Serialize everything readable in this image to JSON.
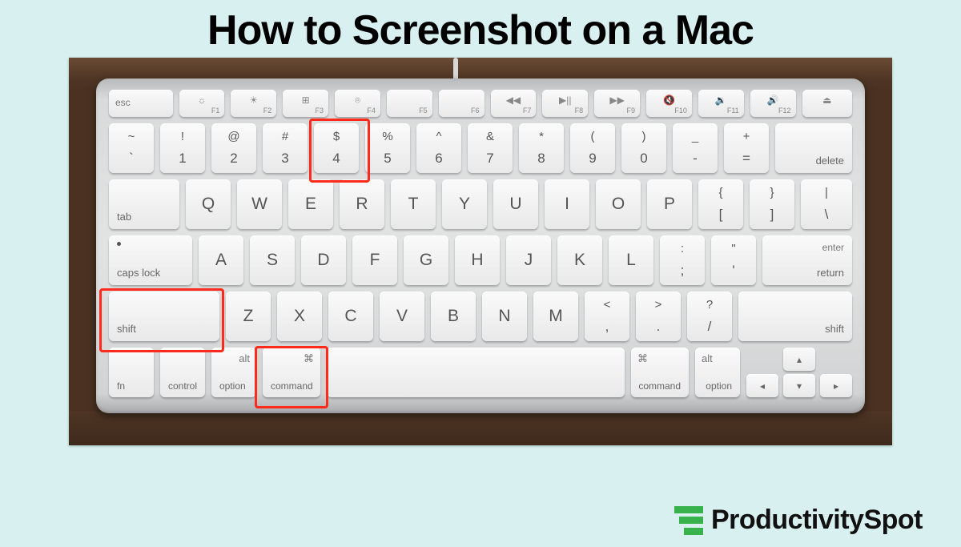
{
  "title": "How to Screenshot on a Mac",
  "brand": "ProductivitySpot",
  "highlighted_keys": [
    "shift",
    "command",
    "4"
  ],
  "fn_row": {
    "esc": "esc",
    "keys": [
      {
        "icon": "☼",
        "label": "F1"
      },
      {
        "icon": "☀",
        "label": "F2"
      },
      {
        "icon": "⊞",
        "label": "F3"
      },
      {
        "icon": "⌾",
        "label": "F4"
      },
      {
        "icon": "",
        "label": "F5"
      },
      {
        "icon": "",
        "label": "F6"
      },
      {
        "icon": "◀◀",
        "label": "F7"
      },
      {
        "icon": "▶||",
        "label": "F8"
      },
      {
        "icon": "▶▶",
        "label": "F9"
      },
      {
        "icon": "🔇",
        "label": "F10"
      },
      {
        "icon": "🔉",
        "label": "F11"
      },
      {
        "icon": "🔊",
        "label": "F12"
      }
    ],
    "eject": "⏏"
  },
  "num_row": {
    "keys": [
      {
        "top": "~",
        "bot": "`"
      },
      {
        "top": "!",
        "bot": "1"
      },
      {
        "top": "@",
        "bot": "2"
      },
      {
        "top": "#",
        "bot": "3"
      },
      {
        "top": "$",
        "bot": "4"
      },
      {
        "top": "%",
        "bot": "5"
      },
      {
        "top": "^",
        "bot": "6"
      },
      {
        "top": "&",
        "bot": "7"
      },
      {
        "top": "*",
        "bot": "8"
      },
      {
        "top": "(",
        "bot": "9"
      },
      {
        "top": ")",
        "bot": "0"
      },
      {
        "top": "_",
        "bot": "-"
      },
      {
        "top": "+",
        "bot": "="
      }
    ],
    "delete": "delete"
  },
  "q_row": {
    "tab": "tab",
    "letters": [
      "Q",
      "W",
      "E",
      "R",
      "T",
      "Y",
      "U",
      "I",
      "O",
      "P"
    ],
    "br1": {
      "top": "{",
      "bot": "["
    },
    "br2": {
      "top": "}",
      "bot": "]"
    },
    "bs": {
      "top": "|",
      "bot": "\\"
    }
  },
  "a_row": {
    "caps": "caps lock",
    "letters": [
      "A",
      "S",
      "D",
      "F",
      "G",
      "H",
      "J",
      "K",
      "L"
    ],
    "semi": {
      "top": ":",
      "bot": ";"
    },
    "quote": {
      "top": "\"",
      "bot": "'"
    },
    "enter_top": "enter",
    "return": "return"
  },
  "z_row": {
    "shift_l": "shift",
    "letters": [
      "Z",
      "X",
      "C",
      "V",
      "B",
      "N",
      "M"
    ],
    "comma": {
      "top": "<",
      "bot": ","
    },
    "period": {
      "top": ">",
      "bot": "."
    },
    "slash": {
      "top": "?",
      "bot": "/"
    },
    "shift_r": "shift"
  },
  "bot_row": {
    "fn": "fn",
    "control": "control",
    "option_l": "option",
    "alt": "alt",
    "command_l": "command",
    "cmd_sym": "⌘",
    "command_r": "command",
    "option_r": "option",
    "arrows": {
      "up": "▴",
      "left": "◂",
      "down": "▾",
      "right": "▸"
    }
  }
}
